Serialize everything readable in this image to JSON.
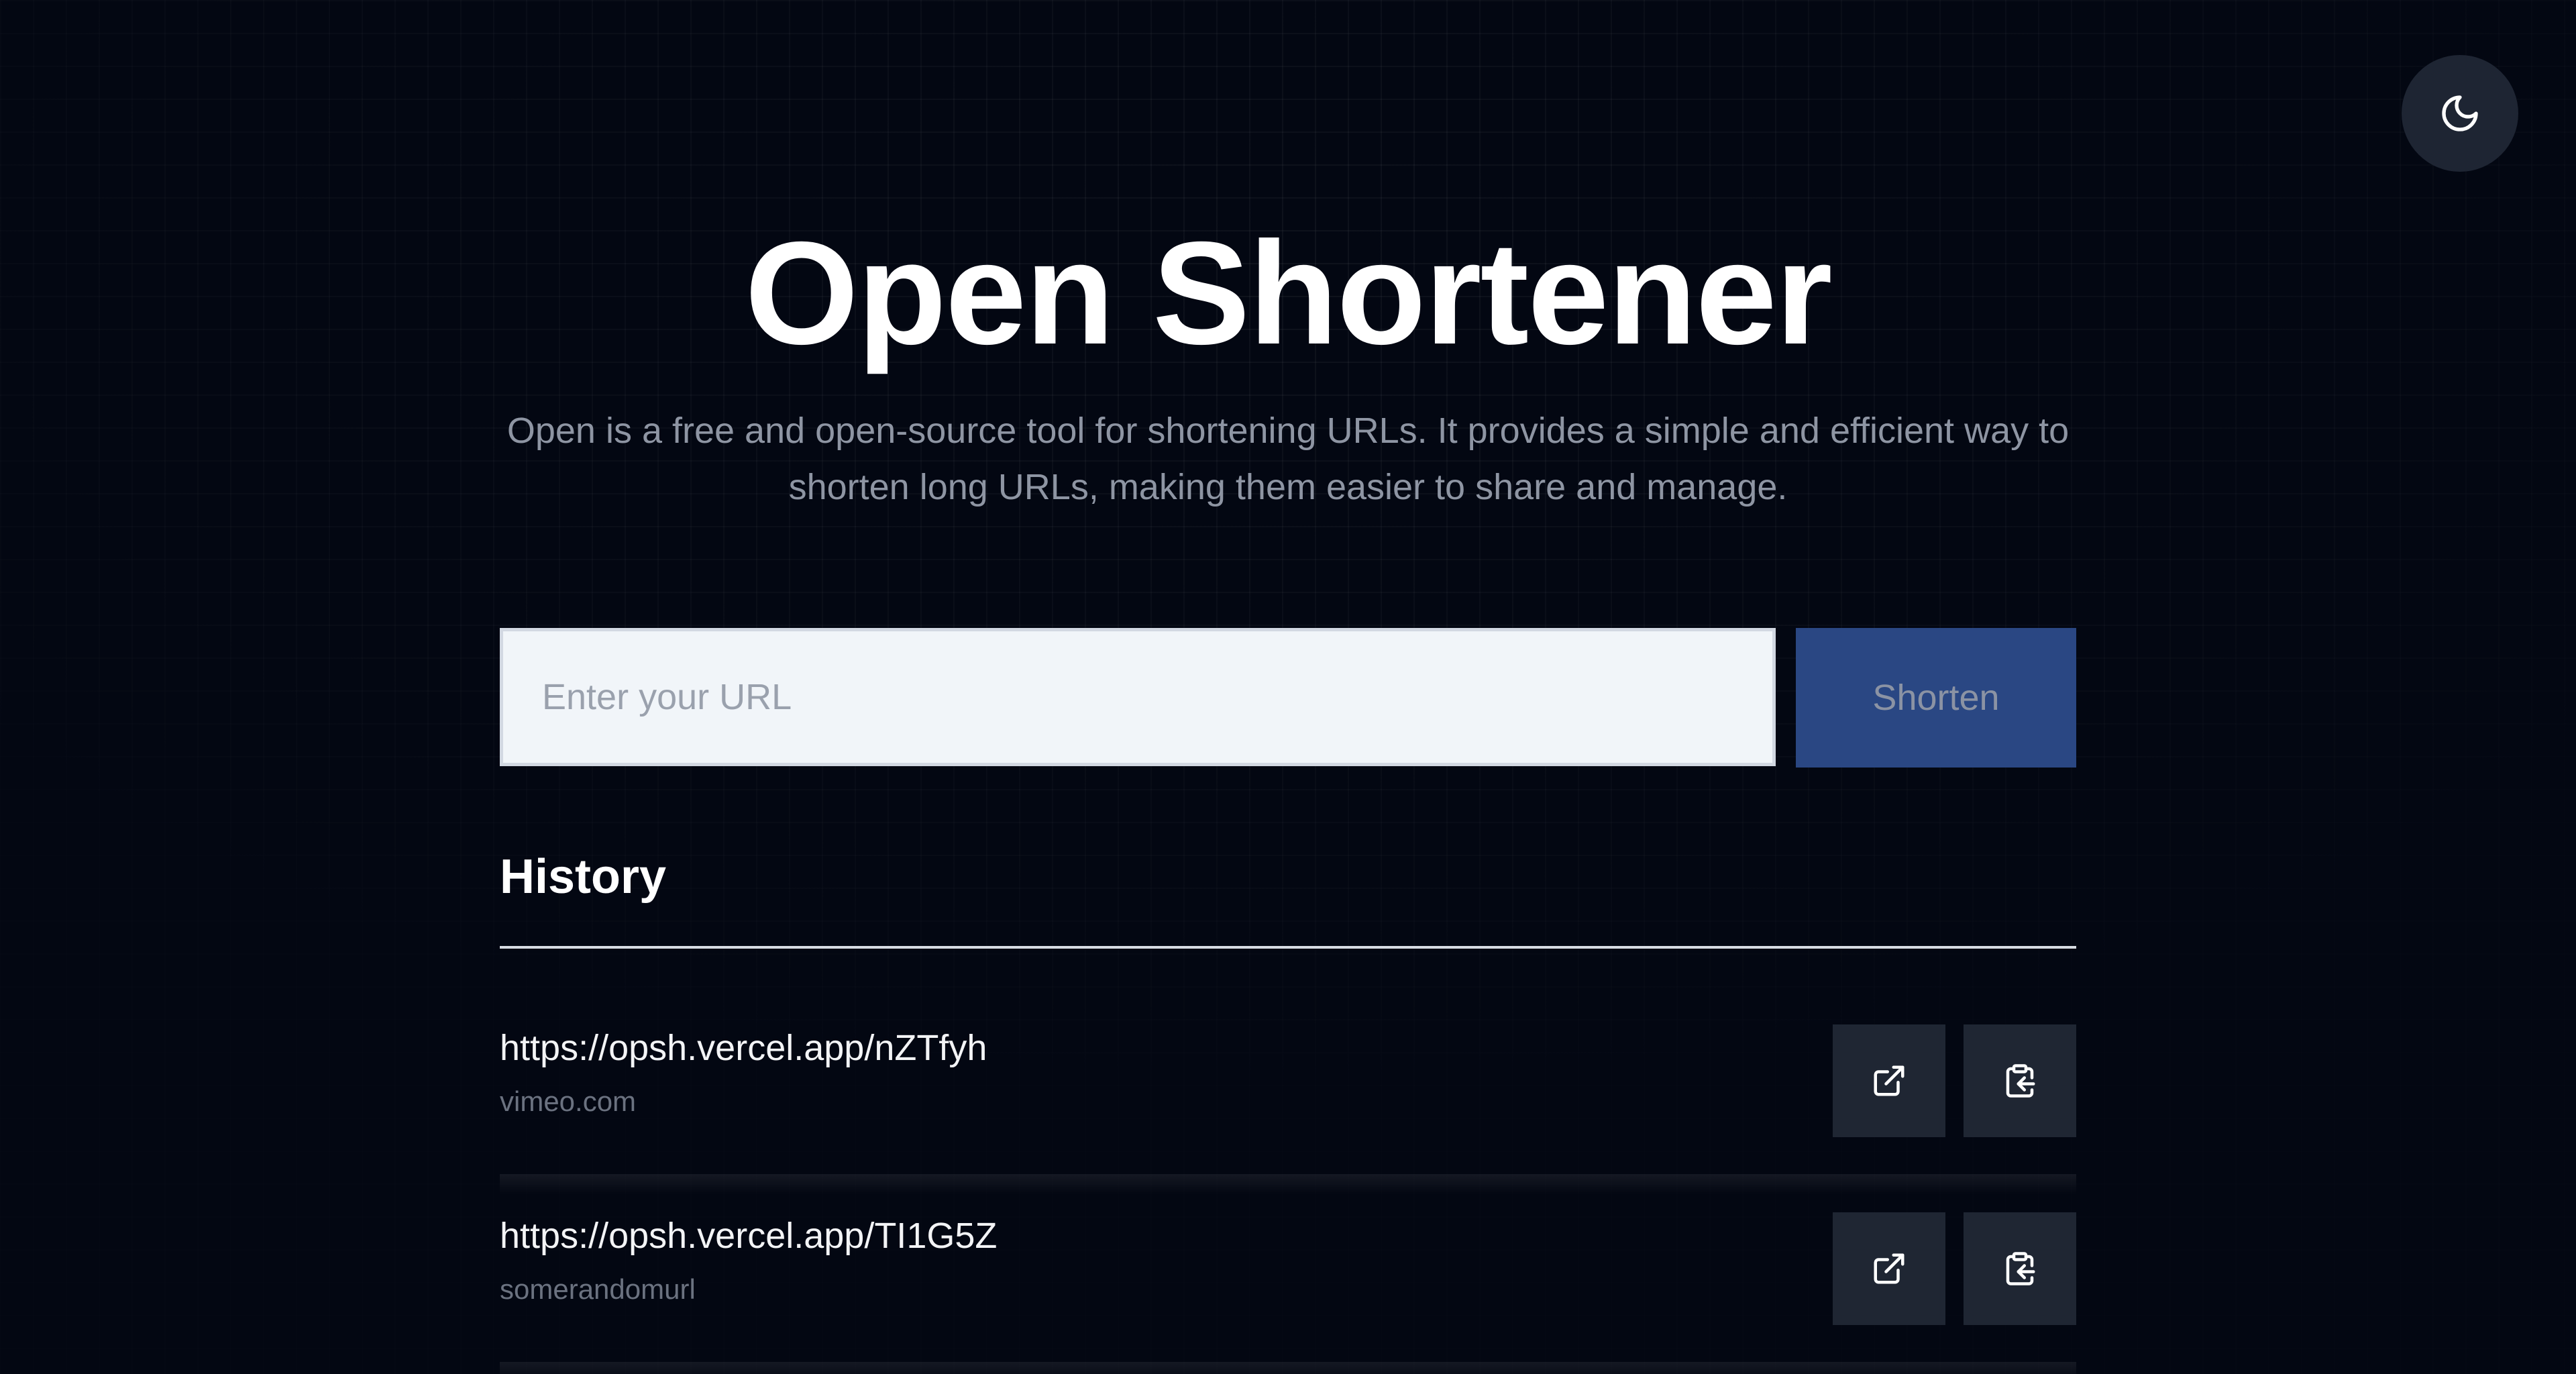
{
  "header": {
    "title": "Open Shortener",
    "subtitle": "Open is a free and open-source tool for shortening URLs. It provides a simple and efficient way to shorten long URLs, making them easier to share and manage."
  },
  "theme_toggle": {
    "icon": "moon-icon"
  },
  "form": {
    "input_placeholder": "Enter your URL",
    "input_value": "",
    "submit_label": "Shorten"
  },
  "history": {
    "title": "History",
    "items": [
      {
        "short_url": "https://opsh.vercel.app/nZTfyh",
        "domain": "vimeo.com",
        "open_icon": "external-link-icon",
        "copy_icon": "clipboard-copy-icon"
      },
      {
        "short_url": "https://opsh.vercel.app/TI1G5Z",
        "domain": "somerandomurl",
        "open_icon": "external-link-icon",
        "copy_icon": "clipboard-copy-icon"
      }
    ]
  },
  "colors": {
    "background": "#030712",
    "button_primary": "#2a4783",
    "icon_button": "#1f2633",
    "muted_text": "#8e95a3"
  }
}
